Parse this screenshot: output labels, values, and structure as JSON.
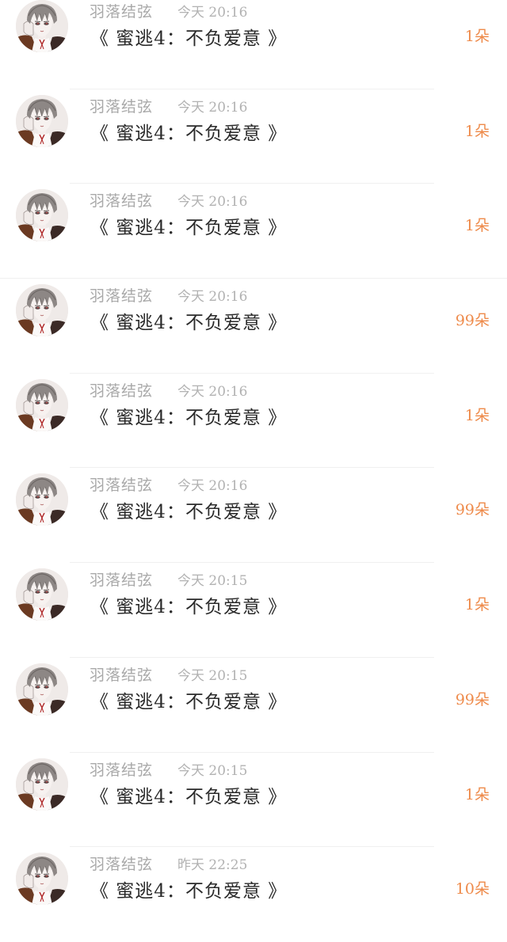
{
  "gift_records": [
    {
      "user": "羽落结弦",
      "time": "今天 20:16",
      "gift": "《 蜜逃4：不负爱意 》",
      "count": "1朵"
    },
    {
      "user": "羽落结弦",
      "time": "今天 20:16",
      "gift": "《 蜜逃4：不负爱意 》",
      "count": "1朵"
    },
    {
      "user": "羽落结弦",
      "time": "今天 20:16",
      "gift": "《 蜜逃4：不负爱意 》",
      "count": "1朵"
    },
    {
      "user": "羽落结弦",
      "time": "今天 20:16",
      "gift": "《 蜜逃4：不负爱意 》",
      "count": "99朵"
    },
    {
      "user": "羽落结弦",
      "time": "今天 20:16",
      "gift": "《 蜜逃4：不负爱意 》",
      "count": "1朵"
    },
    {
      "user": "羽落结弦",
      "time": "今天 20:16",
      "gift": "《 蜜逃4：不负爱意 》",
      "count": "99朵"
    },
    {
      "user": "羽落结弦",
      "time": "今天 20:15",
      "gift": "《 蜜逃4：不负爱意 》",
      "count": "1朵"
    },
    {
      "user": "羽落结弦",
      "time": "今天 20:15",
      "gift": "《 蜜逃4：不负爱意 》",
      "count": "99朵"
    },
    {
      "user": "羽落结弦",
      "time": "今天 20:15",
      "gift": "《 蜜逃4：不负爱意 》",
      "count": "1朵"
    },
    {
      "user": "羽落结弦",
      "time": "昨天 22:25",
      "gift": "《 蜜逃4：不负爱意 》",
      "count": "10朵"
    }
  ],
  "colors": {
    "count_accent": "#ee8a4a",
    "username": "#a9a9a9",
    "time": "#b2b2b2",
    "gift_title": "#2a2a2a"
  },
  "icons": {
    "avatar": "anime-boy-portrait-avatar"
  }
}
